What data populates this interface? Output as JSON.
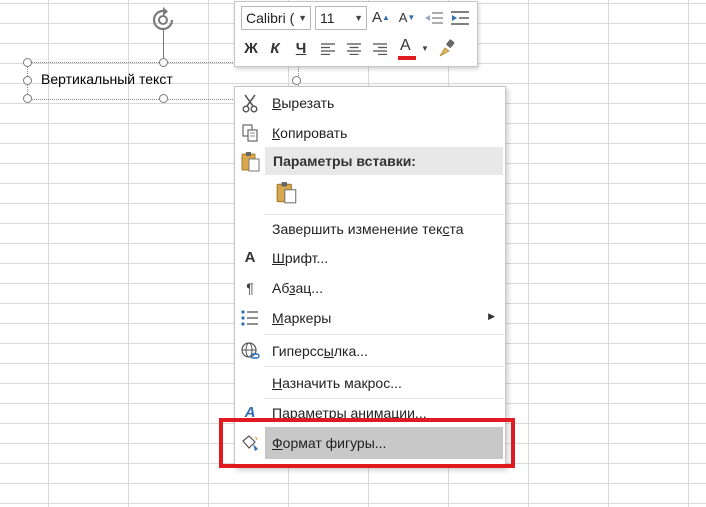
{
  "shape": {
    "text": "Вертикальный текст"
  },
  "mini_toolbar": {
    "font_name": "Calibri (",
    "font_size": "11",
    "grow_font": "A",
    "shrink_font": "A",
    "bold": "Ж",
    "italic": "К",
    "underline": "Ч",
    "font_color_glyph": "A",
    "font_color": "#e11a22"
  },
  "context_menu": {
    "items": [
      {
        "label": "Вырезать",
        "accel": "В",
        "rest": "ырезать",
        "icon": "scissors-icon"
      },
      {
        "label": "Копировать",
        "accel": "К",
        "rest": "опировать",
        "icon": "copy-icon"
      },
      {
        "header": "Параметры вставки:",
        "icon": "paste-icon"
      },
      {
        "label": "Завершить изменение текста",
        "before": "Завершить изменение тек",
        "accel": "с",
        "rest": "та"
      },
      {
        "label": "Шрифт...",
        "accel": "Ш",
        "rest": "рифт...",
        "icon": "font-icon"
      },
      {
        "label": "Абзац...",
        "before": "Аб",
        "accel": "з",
        "rest": "ац...",
        "icon": "paragraph-icon"
      },
      {
        "label": "Маркеры",
        "accel": "М",
        "rest": "аркеры",
        "icon": "bullets-icon"
      },
      {
        "label": "Гиперссылка...",
        "before": "Гиперсс",
        "accel": "ы",
        "rest": "лка...",
        "icon": "hyperlink-icon"
      },
      {
        "label": "Назначить макрос...",
        "accel": "Н",
        "rest": "азначить макрос..."
      },
      {
        "label": "Параметры анимации...",
        "accel": "П",
        "rest": "араметры анимации...",
        "icon": "animation-icon"
      },
      {
        "label": "Формат фигуры...",
        "accel": "Ф",
        "rest": "ормат фигуры...",
        "icon": "format-shape-icon"
      }
    ]
  },
  "highlight_color": "#e11a22"
}
